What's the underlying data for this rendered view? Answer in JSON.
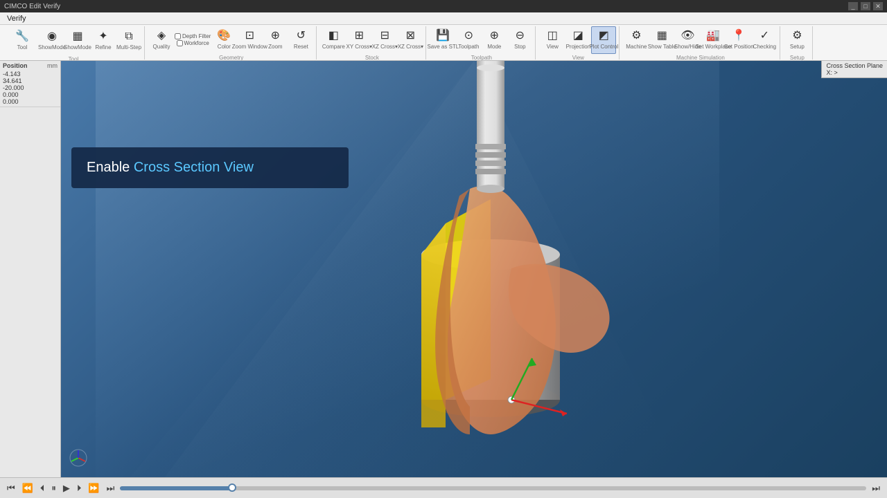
{
  "app": {
    "title": "CIMCO Edit Verify",
    "menu": [
      "Verify"
    ]
  },
  "toolbar": {
    "groups": [
      {
        "label": "Tool",
        "items": [
          {
            "id": "tool",
            "icon": "🔧",
            "label": "Tool"
          },
          {
            "id": "showmode",
            "icon": "◉",
            "label": "ShowMode"
          },
          {
            "id": "showmode2",
            "icon": "▦",
            "label": "ShowMode"
          },
          {
            "id": "refine",
            "icon": "✦",
            "label": "Refine"
          },
          {
            "id": "multistep",
            "icon": "⧉",
            "label": "Multi-Step"
          }
        ]
      },
      {
        "label": "Geometry",
        "items": [
          {
            "id": "quality",
            "icon": "◈",
            "label": "Quality"
          },
          {
            "id": "depthfilter",
            "icon": "▤",
            "label": "Depth Filter"
          },
          {
            "id": "color",
            "icon": "🎨",
            "label": "Color"
          },
          {
            "id": "zoomwindow",
            "icon": "⊡",
            "label": "Zoom Window"
          },
          {
            "id": "zoom",
            "icon": "⊕",
            "label": "Zoom"
          },
          {
            "id": "reset",
            "icon": "↺",
            "label": "Reset"
          }
        ]
      },
      {
        "label": "Stock",
        "items": [
          {
            "id": "compare",
            "icon": "◧",
            "label": "Compare"
          },
          {
            "id": "xycross",
            "icon": "⊞",
            "label": "XY Cross Section▾"
          },
          {
            "id": "xzcross",
            "icon": "⊟",
            "label": "XZ Cross Section▾"
          },
          {
            "id": "xzcross2",
            "icon": "⊠",
            "label": "XZ Cross Section▾"
          }
        ]
      },
      {
        "label": "Toolpath",
        "items": [
          {
            "id": "saveasstl",
            "icon": "💾",
            "label": "Save as STL"
          },
          {
            "id": "toolpath",
            "icon": "⊙",
            "label": "Toolpath"
          },
          {
            "id": "mode",
            "icon": "⊕",
            "label": "Mode"
          },
          {
            "id": "stop",
            "icon": "⊖",
            "label": "Stop"
          },
          {
            "id": "workforce",
            "icon": "⊗",
            "label": "Workforce"
          }
        ]
      },
      {
        "label": "View",
        "items": [
          {
            "id": "view",
            "icon": "◫",
            "label": "View"
          },
          {
            "id": "projection",
            "icon": "◪",
            "label": "Projection"
          },
          {
            "id": "plotcontrol",
            "icon": "◩",
            "label": "Plot Control",
            "active": true
          }
        ]
      },
      {
        "label": "Machine Simulation",
        "items": [
          {
            "id": "machine",
            "icon": "⚙",
            "label": "Machine"
          },
          {
            "id": "showtable",
            "icon": "▦",
            "label": "Show Table"
          },
          {
            "id": "showhide",
            "icon": "👁",
            "label": "Show/Hide"
          },
          {
            "id": "setworkplace",
            "icon": "🏭",
            "label": "Set Workplace"
          },
          {
            "id": "setposition",
            "icon": "📍",
            "label": "Set Position"
          },
          {
            "id": "checking",
            "icon": "✓",
            "label": "Checking"
          }
        ]
      },
      {
        "label": "Setup",
        "items": [
          {
            "id": "setup",
            "icon": "⚙",
            "label": "Setup"
          }
        ]
      }
    ]
  },
  "left_panel": {
    "title": "Position",
    "unit": "mm",
    "rows": [
      {
        "label": "",
        "value": "-4.143"
      },
      {
        "label": "",
        "value": "34.641"
      },
      {
        "label": "",
        "value": "-20.000"
      },
      {
        "label": "",
        "value": "0.000"
      },
      {
        "label": "",
        "value": "0.000"
      }
    ]
  },
  "tooltip": {
    "prefix": "Enable ",
    "highlight": "Cross Section View"
  },
  "cross_section_panel": {
    "label": "Cross Section Plane",
    "sub": "X: >"
  },
  "timeline": {
    "fill_percent": 15,
    "thumb_percent": 15,
    "buttons": [
      "⏮",
      "⏪",
      "⏴",
      "⏸",
      "▶",
      "⏩",
      "⏭"
    ],
    "play_btn": "▶",
    "pause_btn": "⏸",
    "rewind_btn": "⏮",
    "prev_btn": "⏪",
    "step_back_btn": "⏴",
    "step_fwd_btn": "⏵",
    "next_btn": "⏩",
    "end_btn": "⏭"
  },
  "logo": "⚙"
}
